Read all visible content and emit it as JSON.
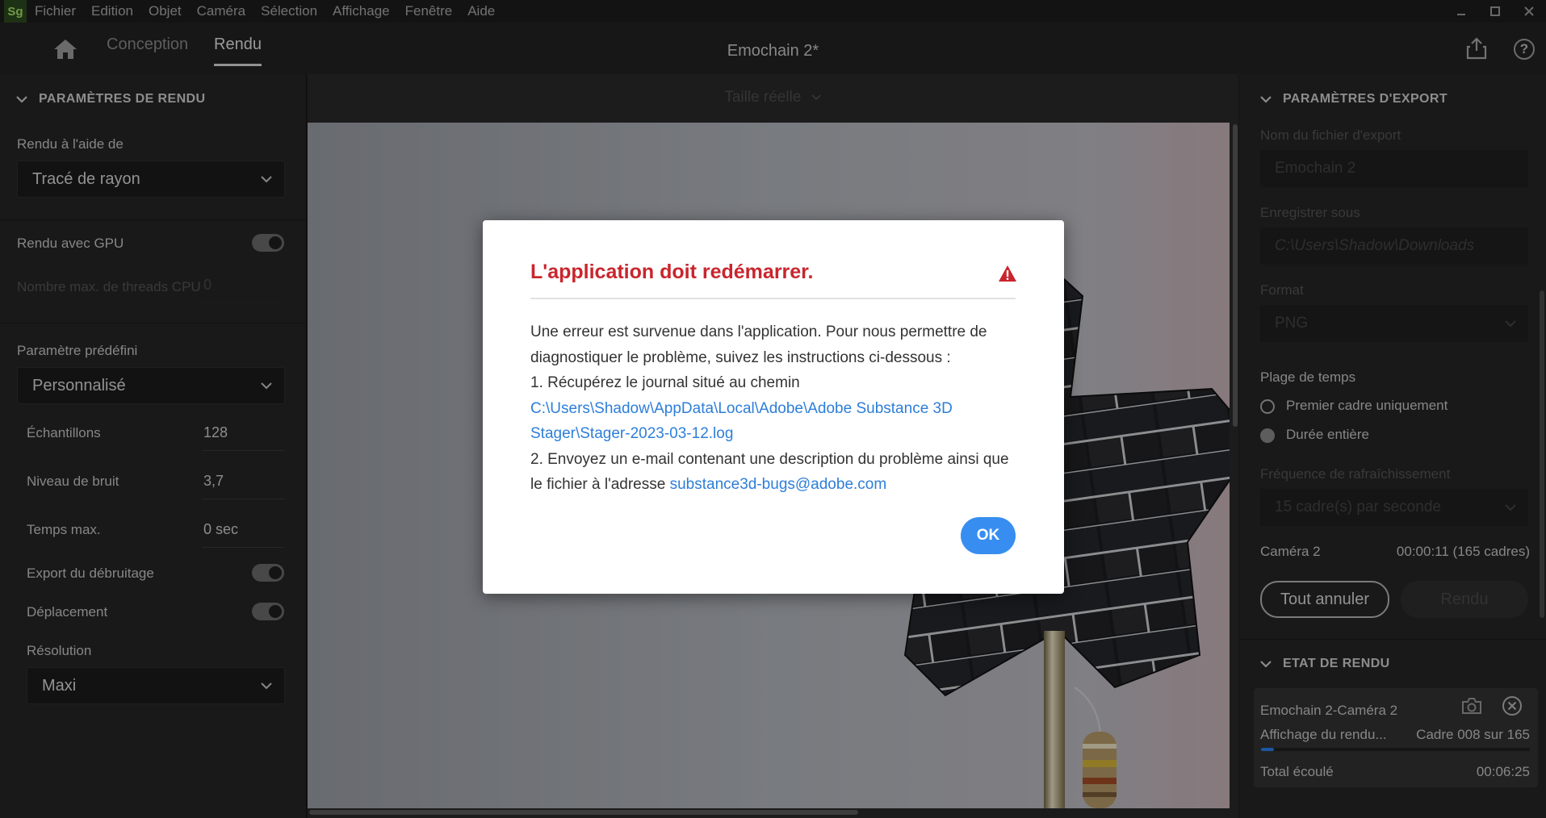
{
  "menu": {
    "logo": "Sg",
    "items": [
      "Fichier",
      "Edition",
      "Objet",
      "Caméra",
      "Sélection",
      "Affichage",
      "Fenêtre",
      "Aide"
    ]
  },
  "topbar": {
    "tabs": [
      "Conception",
      "Rendu"
    ],
    "active_tab": "Rendu",
    "doc_title": "Emochain 2*",
    "help": "?"
  },
  "left": {
    "header": "PARAMÈTRES DE RENDU",
    "render_with_label": "Rendu à l'aide de",
    "render_with_value": "Tracé de rayon",
    "gpu_label": "Rendu avec GPU",
    "gpu_on": true,
    "threads_label": "Nombre max. de threads CPU",
    "threads_value": "0",
    "preset_label": "Paramètre prédéfini",
    "preset_value": "Personnalisé",
    "samples_label": "Échantillons",
    "samples_value": "128",
    "noise_label": "Niveau de bruit",
    "noise_value": "3,7",
    "time_label": "Temps max.",
    "time_value": "0 sec",
    "debug_label": "Export du débruitage",
    "debug_on": true,
    "motion_label": "Déplacement",
    "motion_on": true,
    "resolution_label": "Résolution",
    "resolution_value": "Maxi"
  },
  "viewport": {
    "size_select": "Taille réelle"
  },
  "right": {
    "header": "PARAMÈTRES D'EXPORT",
    "filename_label": "Nom du fichier d'export",
    "filename_value": "Emochain 2",
    "save_label": "Enregistrer sous",
    "save_value": "C:\\Users\\Shadow\\Downloads",
    "format_label": "Format",
    "format_value": "PNG",
    "range_label": "Plage de temps",
    "range_options": [
      "Premier cadre uniquement",
      "Durée entière"
    ],
    "range_selected": "Durée entière",
    "fps_label": "Fréquence de rafraîchissement",
    "fps_value": "15 cadre(s) par seconde",
    "camera_label": "Caméra 2",
    "camera_duration": "00:00:11 (165 cadres)",
    "cancel_all": "Tout annuler",
    "render_btn": "Rendu",
    "status_header": "ETAT DE RENDU",
    "job_name": "Emochain 2-Caméra 2",
    "job_status": "Affichage du rendu...",
    "job_frame": "Cadre 008 sur 165",
    "job_progress": 0.048,
    "total_label": "Total écoulé",
    "total_value": "00:06:25"
  },
  "modal": {
    "title": "L'application doit redémarrer.",
    "line1": "Une erreur est survenue dans l'application. Pour nous permettre de diagnostiquer le problème, suivez les instructions ci-dessous :",
    "line2": "1. Récupérez le journal situé au chemin",
    "log_path": "C:\\Users\\Shadow\\AppData\\Local\\Adobe\\Adobe Substance 3D Stager\\Stager-2023-03-12.log",
    "line3": "2. Envoyez un e-mail contenant une description du problème ainsi que le fichier à l'adresse",
    "email": "substance3d-bugs@adobe.com",
    "ok": "OK"
  },
  "colors": {
    "accent": "#378ef0",
    "error": "#c9252d",
    "link": "#2d7ed9",
    "progress": "#2680eb"
  }
}
